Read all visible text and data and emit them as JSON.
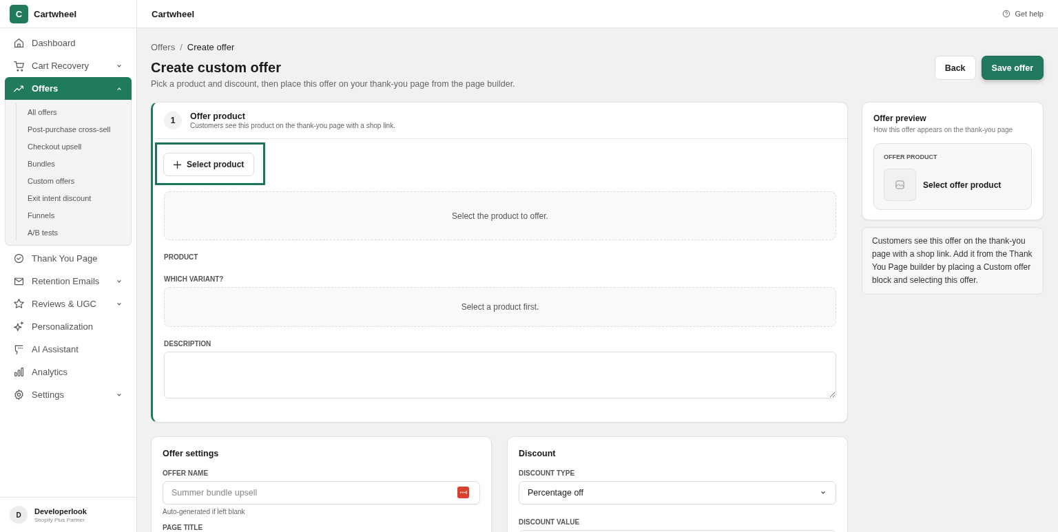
{
  "brand": {
    "logo_letter": "C",
    "name": "Cartwheel"
  },
  "sidebar": {
    "items": [
      {
        "label": "Dashboard",
        "kind": "link",
        "selected": false
      },
      {
        "label": "Cart Recovery",
        "kind": "group",
        "selected": false,
        "expanded": false
      },
      {
        "label": "Offers",
        "kind": "group",
        "selected": true,
        "expanded": true,
        "children": [
          {
            "label": "All offers",
            "selected": false
          },
          {
            "label": "Post-purchase cross-sell",
            "selected": false
          },
          {
            "label": "Checkout upsell",
            "selected": false
          },
          {
            "label": "Bundles",
            "selected": false
          },
          {
            "label": "Custom offers",
            "selected": false
          },
          {
            "label": "Exit intent discount",
            "selected": false
          },
          {
            "label": "Funnels",
            "selected": false
          },
          {
            "label": "A/B tests",
            "selected": false
          }
        ]
      },
      {
        "label": "Thank You Page",
        "kind": "link",
        "selected": false
      },
      {
        "label": "Retention Emails",
        "kind": "group",
        "selected": false,
        "expanded": false
      },
      {
        "label": "Reviews & UGC",
        "kind": "group",
        "selected": false,
        "expanded": false
      },
      {
        "label": "Personalization",
        "kind": "link",
        "selected": false
      },
      {
        "label": "AI Assistant",
        "kind": "link",
        "selected": false
      },
      {
        "label": "Analytics",
        "kind": "link",
        "selected": false
      },
      {
        "label": "Settings",
        "kind": "group",
        "selected": false,
        "expanded": false
      }
    ],
    "user": {
      "initial": "D",
      "name": "Developerlook",
      "role": "Shopify Plus Partner"
    }
  },
  "topbar": {
    "title": "Cartwheel",
    "help": "Get help"
  },
  "breadcrumb": [
    "Offers",
    "Create offer"
  ],
  "breadcrumb_separator": "/",
  "page": {
    "title": "Create custom offer",
    "subtitle": "Pick a product and discount, then place this offer on your thank-you page from the page builder.",
    "buttons": [
      {
        "label": "Back",
        "kind": "secondary"
      },
      {
        "label": "Save offer",
        "kind": "primary"
      }
    ]
  },
  "offer_product": {
    "step": "1",
    "title": "Offer product",
    "subtitle": "Customers see this product on the thank-you page with a shop link.",
    "active": true,
    "select_button": {
      "label": "Select product",
      "focused": true
    },
    "empty_product": "Select the product to offer.",
    "product_label": "PRODUCT",
    "variant_label": "WHICH VARIANT?",
    "variant_empty": "Select a product first.",
    "description_label": "DESCRIPTION"
  },
  "offer_settings": {
    "title": "Offer settings",
    "name_label": "OFFER NAME",
    "name_placeholder": "Summer bundle upsell",
    "name_hint": "Auto-generated if left blank",
    "page_title_label": "PAGE TITLE"
  },
  "discount": {
    "title": "Discount",
    "type_label": "DISCOUNT TYPE",
    "type_value": "Percentage off",
    "value_label": "DISCOUNT VALUE"
  },
  "preview": {
    "title": "Offer preview",
    "subtitle": "How this offer appears on the thank-you page",
    "section_label": "OFFER PRODUCT",
    "product_text": "Select offer product"
  },
  "info": "Customers see this offer on the thank-you page with a shop link. Add it from the Thank You Page builder by placing a Custom offer block and selecting this offer."
}
